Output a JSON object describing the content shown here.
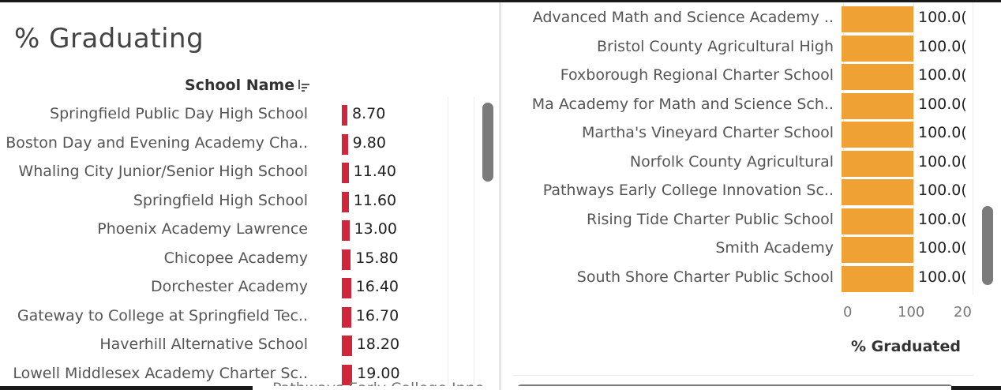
{
  "title": "% Graduating",
  "left_panel": {
    "column_header": "School Name",
    "rows": [
      {
        "name": "Springfield Public Day High School",
        "value": "8.70",
        "num": 8.7
      },
      {
        "name": "Boston Day and Evening Academy Cha..",
        "value": "9.80",
        "num": 9.8
      },
      {
        "name": "Whaling City Junior/Senior High School",
        "value": "11.40",
        "num": 11.4
      },
      {
        "name": "Springfield High School",
        "value": "11.60",
        "num": 11.6
      },
      {
        "name": "Phoenix Academy Lawrence",
        "value": "13.00",
        "num": 13.0
      },
      {
        "name": "Chicopee Academy",
        "value": "15.80",
        "num": 15.8
      },
      {
        "name": "Dorchester Academy",
        "value": "16.40",
        "num": 16.4
      },
      {
        "name": "Gateway to College at Springfield Tec..",
        "value": "16.70",
        "num": 16.7
      },
      {
        "name": "Haverhill Alternative School",
        "value": "18.20",
        "num": 18.2
      },
      {
        "name": "Lowell Middlesex Academy Charter Sc..",
        "value": "19.00",
        "num": 19.0
      }
    ],
    "bar_color": "#d0263c",
    "partial_bottom_label": "Pathways Early College Inno"
  },
  "right_panel": {
    "rows": [
      {
        "name": "Advanced Math and Science Academy ..",
        "value": "100.0("
      },
      {
        "name": "Bristol County Agricultural High",
        "value": "100.0("
      },
      {
        "name": "Foxborough Regional Charter School",
        "value": "100.0("
      },
      {
        "name": "Ma Academy for Math and Science Sch..",
        "value": "100.0("
      },
      {
        "name": "Martha's Vineyard Charter School",
        "value": "100.0("
      },
      {
        "name": "Norfolk County Agricultural",
        "value": "100.0("
      },
      {
        "name": "Pathways Early College Innovation Sc..",
        "value": "100.0("
      },
      {
        "name": "Rising Tide Charter Public School",
        "value": "100.0("
      },
      {
        "name": "Smith Academy",
        "value": "100.0("
      },
      {
        "name": "South Shore Charter Public School",
        "value": "100.0("
      }
    ],
    "bar_color": "#f0a133",
    "axis_ticks": [
      "0",
      "100",
      "20"
    ],
    "axis_title": "% Graduated"
  }
}
